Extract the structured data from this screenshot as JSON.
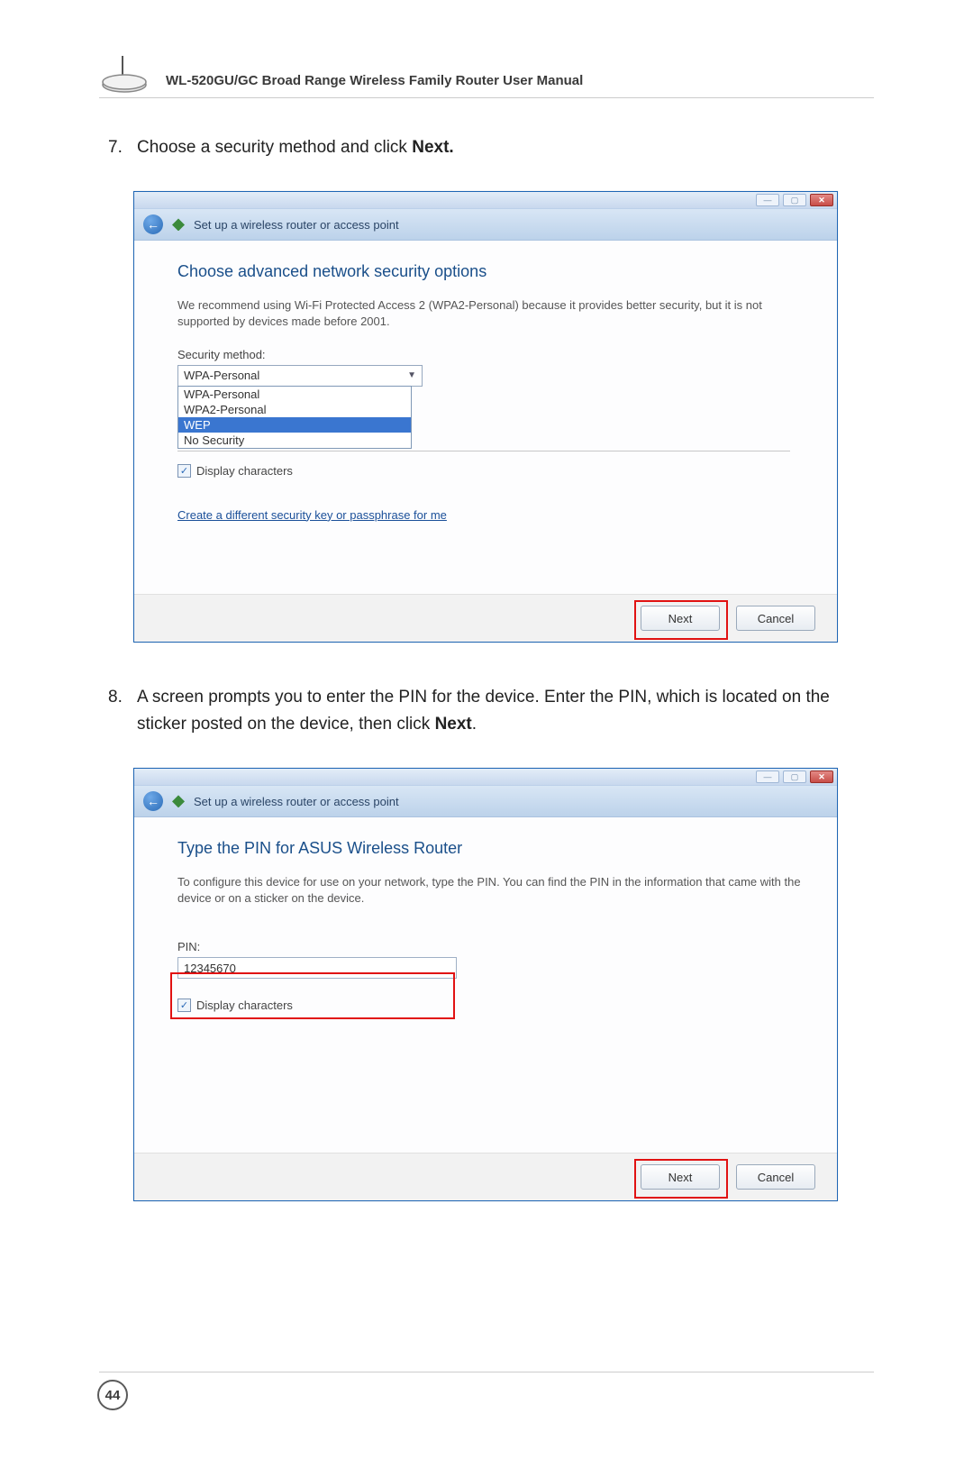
{
  "header": {
    "manual_title": "WL-520GU/GC Broad Range Wireless Family Router User Manual"
  },
  "step7": {
    "number": "7.",
    "text_before_bold": "Choose a security method and click ",
    "bold_word": "Next.",
    "text_after_bold": ""
  },
  "dialog1": {
    "nav_title": "Set up a wireless router or access point",
    "heading": "Choose advanced network security options",
    "description": "We recommend using Wi-Fi Protected Access 2 (WPA2-Personal) because it provides better security,  but it is not supported by devices made before 2001.",
    "security_label": "Security method:",
    "selected": "WPA-Personal",
    "options": [
      "WPA-Personal",
      "WPA2-Personal",
      "WEP",
      "No Security"
    ],
    "highlighted_option_index": 2,
    "display_characters_label": "Display characters",
    "create_link": "Create a different security key or passphrase for me",
    "btn_next": "Next",
    "btn_cancel": "Cancel"
  },
  "step8": {
    "number": "8.",
    "part1": "A screen prompts you to enter the PIN for the device. Enter the PIN, which is located on the sticker posted on the device, then click ",
    "bold_word": "Next",
    "part2": "."
  },
  "dialog2": {
    "nav_title": "Set up a wireless router or access point",
    "heading": "Type the PIN for ASUS Wireless Router",
    "description": "To configure this device for use on your network, type the PIN. You can find the PIN in the information that came with the device or on a sticker on the device.",
    "pin_label": "PIN:",
    "pin_value": "12345670",
    "display_characters_label": "Display characters",
    "btn_next": "Next",
    "btn_cancel": "Cancel"
  },
  "page_number": "44"
}
